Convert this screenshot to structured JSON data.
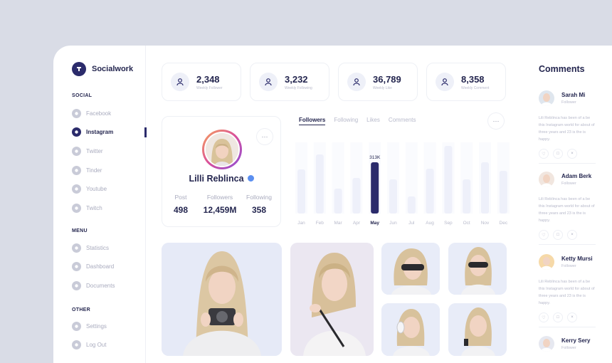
{
  "brand": {
    "name": "Socialwork"
  },
  "sidebar": {
    "social_title": "SOCIAL",
    "social": [
      {
        "label": "Facebook",
        "icon": "facebook-icon"
      },
      {
        "label": "Instagram",
        "icon": "instagram-icon",
        "active": true
      },
      {
        "label": "Twitter",
        "icon": "twitter-icon"
      },
      {
        "label": "Tinder",
        "icon": "tinder-icon"
      },
      {
        "label": "Youtube",
        "icon": "youtube-icon"
      },
      {
        "label": "Twitch",
        "icon": "twitch-icon"
      }
    ],
    "menu_title": "MENU",
    "menu": [
      {
        "label": "Statistics",
        "icon": "statistics-icon"
      },
      {
        "label": "Dashboard",
        "icon": "dashboard-icon"
      },
      {
        "label": "Documents",
        "icon": "documents-icon"
      }
    ],
    "other_title": "OTHER",
    "other": [
      {
        "label": "Settings",
        "icon": "settings-icon"
      },
      {
        "label": "Log Out",
        "icon": "logout-icon"
      }
    ]
  },
  "stats": [
    {
      "value": "2,348",
      "label": "Weekly Follower",
      "icon": "user-add-icon"
    },
    {
      "value": "3,232",
      "label": "Weekly Following",
      "icon": "user-follow-icon"
    },
    {
      "value": "36,789",
      "label": "Weekly Like",
      "icon": "user-like-icon"
    },
    {
      "value": "8,358",
      "label": "Weekly Comment",
      "icon": "users-comment-icon"
    }
  ],
  "profile": {
    "name": "Lilli Reblinca",
    "post_label": "Post",
    "post_value": "498",
    "followers_label": "Followers",
    "followers_value": "12,459M",
    "following_label": "Following",
    "following_value": "358",
    "more": "···"
  },
  "chart_tabs": [
    "Followers",
    "Following",
    "Likes",
    "Comments"
  ],
  "chart_more": "···",
  "chart_data": {
    "type": "bar",
    "categories": [
      "Jan",
      "Feb",
      "Mar",
      "Apr",
      "May",
      "Jun",
      "Jul",
      "Aug",
      "Sep",
      "Oct",
      "Nov",
      "Dec"
    ],
    "values": [
      0.62,
      0.83,
      0.35,
      0.5,
      0.72,
      0.48,
      0.24,
      0.63,
      0.95,
      0.48,
      0.72,
      0.6
    ],
    "highlight_index": 4,
    "highlight_label": "313K",
    "bar_color": "#eef0fa",
    "highlight_color": "#2b2b6b"
  },
  "comments_title": "Comments",
  "comments": [
    {
      "name": "Sarah Mi",
      "role": "Follower",
      "text": "Lili Reblinca has been of a  be this Instagram world for  about of three years and 23 is the is happy.",
      "avatar_bg": "#dfe6ee"
    },
    {
      "name": "Adam Berk",
      "role": "Follower",
      "text": "Lili Reblinca has been of a  be this Instagram world for  about of three years and 23 is the is happy.",
      "avatar_bg": "#f1e6df"
    },
    {
      "name": "Ketty Mursi",
      "role": "Follower",
      "text": "Lili Reblinca has been of a  be this Instagram world for  about of three years and 23 is the is happy.",
      "avatar_bg": "#f6d9a8"
    },
    {
      "name": "Kerry Sery",
      "role": "Follower",
      "text": "",
      "avatar_bg": "#e6e8f0"
    }
  ],
  "colors": {
    "accent": "#2b2b6b",
    "muted": "#b8bacb",
    "text": "#24264f"
  }
}
